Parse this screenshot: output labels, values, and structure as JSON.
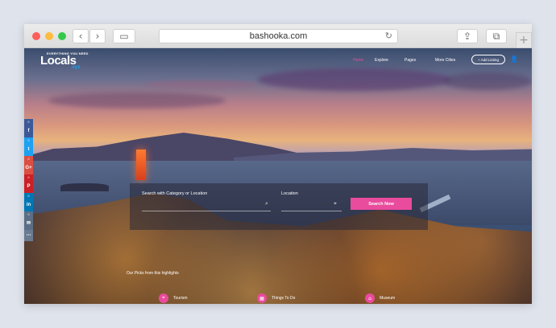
{
  "browser": {
    "url": "bashooka.com",
    "back_icon": "‹",
    "forward_icon": "›",
    "sidebar_icon": "▭",
    "reload_icon": "↻",
    "share_icon": "⇪",
    "tabs_icon": "⧉",
    "newtab_icon": "+"
  },
  "site": {
    "logo_tagline": "EVERYTHING YOU NEED",
    "logo_name": "Locals",
    "logo_sub": ".xyz",
    "nav": {
      "home": "Home",
      "explore": "Explore",
      "pages": "Pages",
      "more": "More Cities",
      "add_listing": "+ Add Listing",
      "user_icon": "👤"
    },
    "accent_color": "#e94b9d"
  },
  "social": [
    {
      "count": "0",
      "glyph": "f"
    },
    {
      "count": "0",
      "glyph": "t"
    },
    {
      "count": "0",
      "glyph": "G+"
    },
    {
      "count": "0",
      "glyph": "P"
    },
    {
      "count": "0",
      "glyph": "in"
    },
    {
      "count": "0",
      "glyph": "✉"
    },
    {
      "glyph": "⋯"
    }
  ],
  "search": {
    "category_label": "Search with Category or Location",
    "location_label": "Location",
    "search_icon": "⌕",
    "location_icon": "⌖",
    "button_label": "Search Now"
  },
  "caption": "Our Picks from this highlights",
  "categories": [
    {
      "label": "Tourism",
      "icon": "⌖"
    },
    {
      "label": "Things To Do",
      "icon": "▦"
    },
    {
      "label": "Museum",
      "icon": "⌂"
    }
  ]
}
